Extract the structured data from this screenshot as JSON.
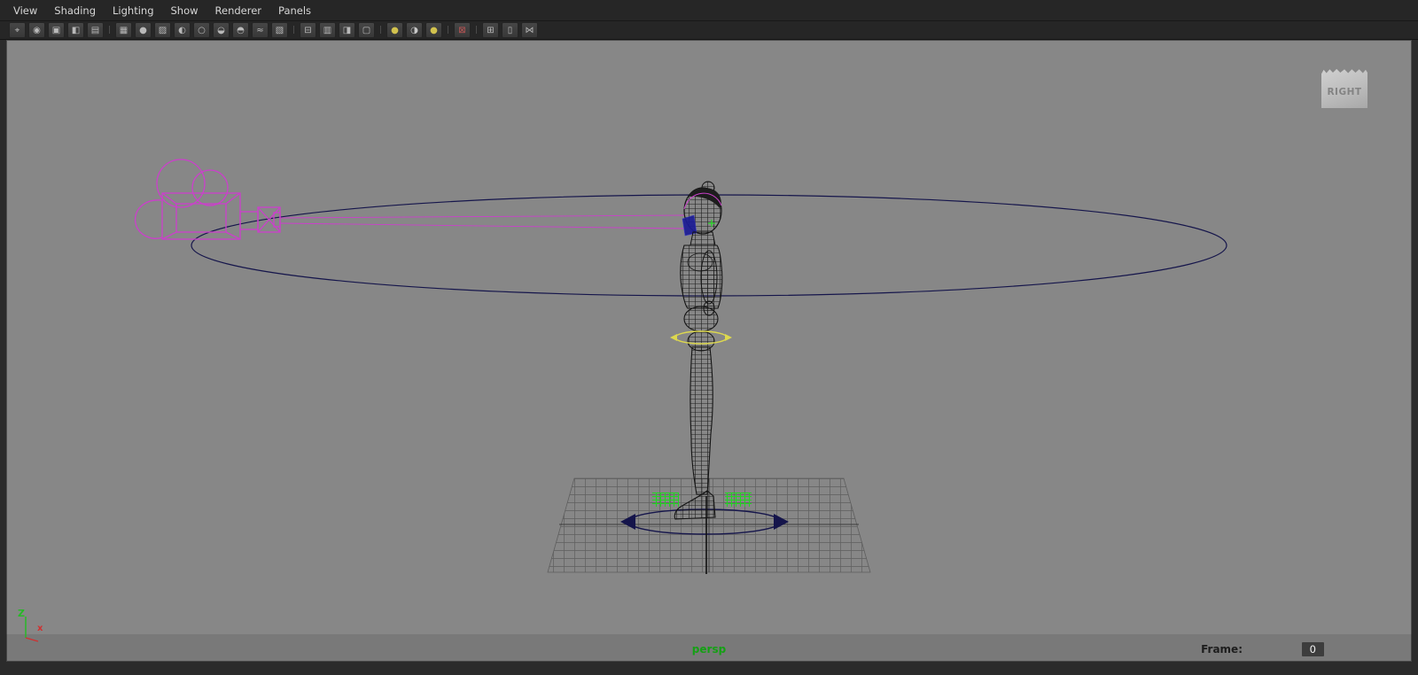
{
  "menubar": {
    "items": [
      {
        "name": "menu-view",
        "label": "View"
      },
      {
        "name": "menu-shading",
        "label": "Shading"
      },
      {
        "name": "menu-lighting",
        "label": "Lighting"
      },
      {
        "name": "menu-show",
        "label": "Show"
      },
      {
        "name": "menu-renderer",
        "label": "Renderer"
      },
      {
        "name": "menu-panels",
        "label": "Panels"
      }
    ]
  },
  "toolbar": {
    "icons": [
      {
        "name": "select-camera-icon",
        "glyph": "⌖"
      },
      {
        "name": "lock-camera-icon",
        "glyph": "◉"
      },
      {
        "name": "camera-attributes-icon",
        "glyph": "▣"
      },
      {
        "name": "bookmarks-icon",
        "glyph": "◧"
      },
      {
        "name": "image-plane-icon",
        "glyph": "▤"
      },
      {
        "name": "separator",
        "glyph": "|",
        "sep": true
      },
      {
        "name": "wireframe-mode-icon",
        "glyph": "▦"
      },
      {
        "name": "smooth-shade-mode-icon",
        "glyph": "●"
      },
      {
        "name": "textured-mode-icon",
        "glyph": "▨"
      },
      {
        "name": "default-material-icon",
        "glyph": "◐"
      },
      {
        "name": "lighting-mode-icon",
        "glyph": "○"
      },
      {
        "name": "shadows-mode-icon",
        "glyph": "◒"
      },
      {
        "name": "occlusion-icon",
        "glyph": "◓"
      },
      {
        "name": "motion-blur-icon",
        "glyph": "≈"
      },
      {
        "name": "multisample-icon",
        "glyph": "▧"
      },
      {
        "name": "separator",
        "glyph": "|",
        "sep": true
      },
      {
        "name": "isolate-select-icon",
        "glyph": "⊟"
      },
      {
        "name": "x-ray-icon",
        "glyph": "▥"
      },
      {
        "name": "gate-mask-icon",
        "glyph": "◨"
      },
      {
        "name": "resolution-gate-icon",
        "glyph": "▢"
      },
      {
        "name": "separator",
        "glyph": "|",
        "sep": true
      },
      {
        "name": "exposure-icon",
        "glyph": "●",
        "color": "#d2c24e"
      },
      {
        "name": "gamma-icon",
        "glyph": "◑",
        "color": "#c8c8c8"
      },
      {
        "name": "color-management-icon",
        "glyph": "●",
        "color": "#d2c24e"
      },
      {
        "name": "separator",
        "glyph": "|",
        "sep": true
      },
      {
        "name": "paint-select-icon",
        "glyph": "⊠",
        "color": "#c25555"
      },
      {
        "name": "separator",
        "glyph": "|",
        "sep": true
      },
      {
        "name": "field-chart-icon",
        "glyph": "⊞"
      },
      {
        "name": "safe-display-icon",
        "glyph": "▯"
      },
      {
        "name": "connections-icon",
        "glyph": "⋈"
      }
    ]
  },
  "viewport": {
    "view_label": "persp",
    "frame_label": "Frame:",
    "frame_value": "0",
    "orientation_card": "RIGHT",
    "axis": {
      "up": "Z",
      "right": "x"
    },
    "colors": {
      "background": "#878787",
      "wireframe": "#151515",
      "camera_magenta": "#cc3fcc",
      "orbit_navy": "#15154b",
      "selection_green": "#2ad42a",
      "manipulator_yellow": "#ddd84e",
      "hud_green": "#15a015"
    }
  }
}
